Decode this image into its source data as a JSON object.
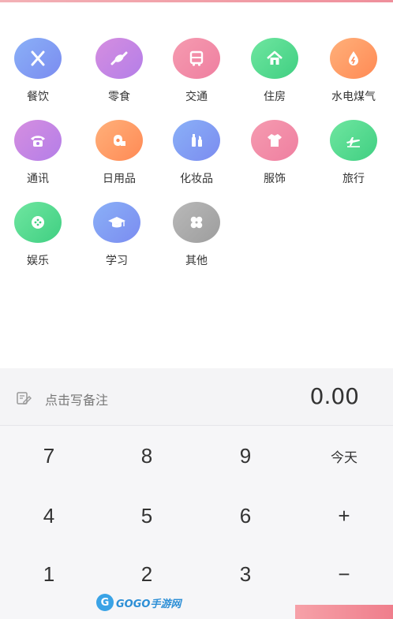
{
  "categories": [
    {
      "label": "餐饮",
      "icon": "utensils-icon",
      "color": "blue"
    },
    {
      "label": "零食",
      "icon": "candy-icon",
      "color": "purple"
    },
    {
      "label": "交通",
      "icon": "bus-icon",
      "color": "pink"
    },
    {
      "label": "住房",
      "icon": "house-icon",
      "color": "green"
    },
    {
      "label": "水电煤气",
      "icon": "water-drop-icon",
      "color": "orange"
    },
    {
      "label": "通讯",
      "icon": "telephone-icon",
      "color": "purple"
    },
    {
      "label": "日用品",
      "icon": "tissue-roll-icon",
      "color": "orange"
    },
    {
      "label": "化妆品",
      "icon": "cosmetics-icon",
      "color": "blue"
    },
    {
      "label": "服饰",
      "icon": "shirt-icon",
      "color": "pink"
    },
    {
      "label": "旅行",
      "icon": "airplane-icon",
      "color": "green"
    },
    {
      "label": "娱乐",
      "icon": "gamepad-icon",
      "color": "green"
    },
    {
      "label": "学习",
      "icon": "graduation-cap-icon",
      "color": "blue"
    },
    {
      "label": "其他",
      "icon": "four-leaf-icon",
      "color": "gray"
    }
  ],
  "note": {
    "placeholder": "点击写备注",
    "icon": "edit-note-icon"
  },
  "amount": "0.00",
  "keypad": {
    "row1": [
      "7",
      "8",
      "9",
      "今天"
    ],
    "row2": [
      "4",
      "5",
      "6",
      "+"
    ],
    "row3": [
      "1",
      "2",
      "3",
      "−"
    ]
  },
  "watermark": {
    "badge": "G",
    "text": "GOGO手游网"
  },
  "colors": {
    "accent_pink": "#ef7e8c",
    "blue": "#7b8cf0",
    "purple": "#b47ee8",
    "pink": "#ef7fa0",
    "green": "#40cf82",
    "orange": "#ff8a55",
    "gray": "#9d9d9d"
  }
}
